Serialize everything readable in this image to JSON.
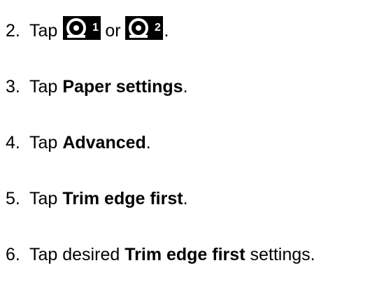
{
  "steps": [
    {
      "number": "2.",
      "text_tap": "Tap",
      "or": "or",
      "period": ".",
      "icons": [
        "roll-1-icon",
        "roll-2-icon"
      ],
      "icon_digits": [
        "1",
        "2"
      ]
    },
    {
      "number": "3.",
      "prefix": "Tap",
      "bold": "Paper settings",
      "suffix": "."
    },
    {
      "number": "4.",
      "prefix": "Tap",
      "bold": "Advanced",
      "suffix": "."
    },
    {
      "number": "5.",
      "prefix": "Tap",
      "bold": "Trim edge first",
      "suffix": "."
    },
    {
      "number": "6.",
      "prefix": "Tap desired",
      "bold": "Trim edge first",
      "suffix": "settings."
    }
  ]
}
